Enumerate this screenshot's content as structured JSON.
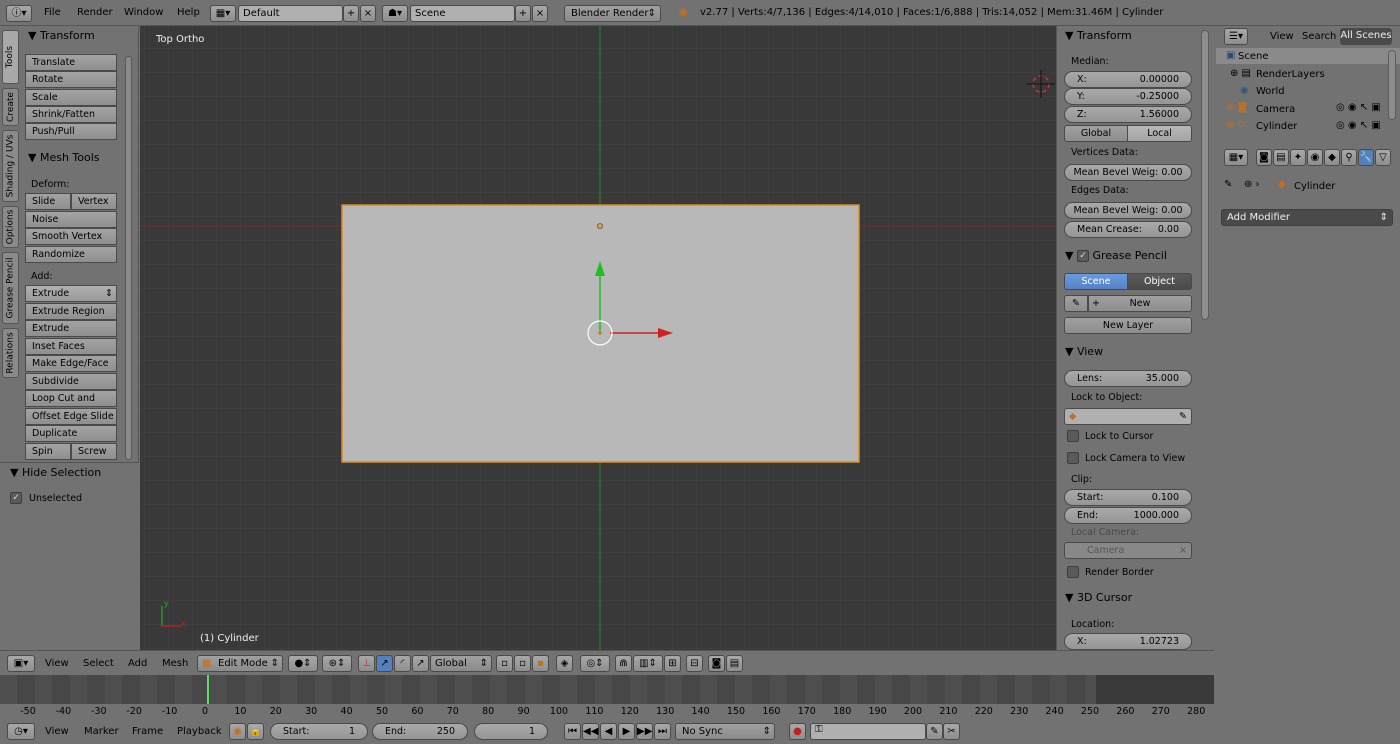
{
  "topbar": {
    "menus": [
      "File",
      "Render",
      "Window",
      "Help"
    ],
    "layout": "Default",
    "scene": "Scene",
    "engine": "Blender Render",
    "info": "v2.77 | Verts:4/7,136 | Edges:4/14,010 | Faces:1/6,888 | Tris:14,052 | Mem:31.46M | Cylinder"
  },
  "vtabs": [
    "Tools",
    "Create",
    "Shading / UVs",
    "Options",
    "Grease Pencil",
    "Relations"
  ],
  "toolshelf": {
    "transform_title": "Transform",
    "transform": [
      "Translate",
      "Rotate",
      "Scale",
      "Shrink/Fatten",
      "Push/Pull"
    ],
    "mesh_title": "Mesh Tools",
    "deform_label": "Deform:",
    "slide_edge": "Slide Ed",
    "vertex": "Vertex",
    "deform": [
      "Noise",
      "Smooth Vertex",
      "Randomize"
    ],
    "add_label": "Add:",
    "extrude": "Extrude",
    "add": [
      "Extrude Region",
      "Extrude Individual",
      "Inset Faces",
      "Make Edge/Face",
      "Subdivide",
      "Loop Cut and Slide",
      "Offset Edge Slide",
      "Duplicate"
    ],
    "spin": "Spin",
    "screw": "Screw",
    "hide_title": "Hide Selection",
    "unselected": "Unselected"
  },
  "viewport": {
    "view_name": "Top Ortho",
    "object_label": "(1) Cylinder"
  },
  "props": {
    "transform_title": "Transform",
    "median": "Median:",
    "x_label": "X:",
    "x": "0.00000",
    "y_label": "Y:",
    "y": "-0.25000",
    "z_label": "Z:",
    "z": "1.56000",
    "global": "Global",
    "local": "Local",
    "vertices_data": "Vertices Data:",
    "mean_bevel_v": "Mean Bevel Weig: 0.00",
    "edges_data": "Edges Data:",
    "mean_bevel_e": "Mean Bevel Weig: 0.00",
    "mean_crease_l": "Mean Crease:",
    "mean_crease": "0.00",
    "gp_title": "Grease Pencil",
    "gp_scene": "Scene",
    "gp_object": "Object",
    "gp_new": "New",
    "gp_new_layer": "New Layer",
    "view_title": "View",
    "lens_l": "Lens:",
    "lens": "35.000",
    "lock_obj": "Lock to Object:",
    "lock_cursor": "Lock to Cursor",
    "lock_camera": "Lock Camera to View",
    "clip": "Clip:",
    "start_l": "Start:",
    "start": "0.100",
    "end_l": "End:",
    "end": "1000.000",
    "local_camera": "Local Camera:",
    "camera": "Camera",
    "render_border": "Render Border",
    "cursor_title": "3D Cursor",
    "location": "Location:",
    "cx_l": "X:",
    "cx": "1.02723"
  },
  "outliner": {
    "view": "View",
    "search": "Search",
    "all_scenes": "All Scenes",
    "items": [
      "Scene",
      "RenderLayers",
      "World",
      "Camera",
      "Cylinder"
    ]
  },
  "propwin": {
    "object": "Cylinder",
    "add_modifier": "Add Modifier"
  },
  "vheader": {
    "menus": [
      "View",
      "Select",
      "Add",
      "Mesh"
    ],
    "mode": "Edit Mode",
    "orientation": "Global"
  },
  "timeline": {
    "ticks": [
      "-50",
      "-40",
      "-30",
      "-20",
      "-10",
      "0",
      "10",
      "20",
      "30",
      "40",
      "50",
      "60",
      "70",
      "80",
      "90",
      "100",
      "110",
      "120",
      "130",
      "140",
      "150",
      "160",
      "170",
      "180",
      "190",
      "200",
      "210",
      "220",
      "230",
      "240",
      "250",
      "260",
      "270",
      "280"
    ]
  },
  "tlheader": {
    "menus": [
      "View",
      "Marker",
      "Frame",
      "Playback"
    ],
    "start_l": "Start:",
    "start": "1",
    "end_l": "End:",
    "end": "250",
    "current": "1",
    "sync": "No Sync"
  }
}
